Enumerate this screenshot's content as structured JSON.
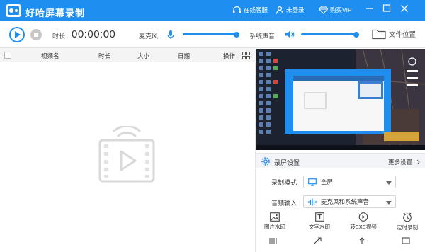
{
  "app": {
    "title": "好哈屏幕录制"
  },
  "titlebar": {
    "online_service": "在线客服",
    "login": "未登录",
    "buy_vip": "购买VIP"
  },
  "controls": {
    "duration_label": "时长:",
    "duration_value": "00:00:00",
    "mic_label": "麦克风:",
    "mic_level": 0.9,
    "system_sound_label": "系统声音:",
    "system_level": 0.9,
    "file_location": "文件位置"
  },
  "list": {
    "columns": [
      "视频名",
      "时长",
      "大小",
      "日期",
      "操作"
    ]
  },
  "settings": {
    "title": "录屏设置",
    "more": "更多设置",
    "record_mode_label": "录制模式",
    "record_mode_value": "全屏",
    "audio_input_label": "音频输入",
    "audio_input_value": "麦克风和系统声音",
    "tools": [
      "图片水印",
      "文字水印",
      "转EXE视频",
      "定时录制"
    ]
  },
  "colors": {
    "accent": "#1e8ff0",
    "titlebar": "#1e8ff0"
  }
}
